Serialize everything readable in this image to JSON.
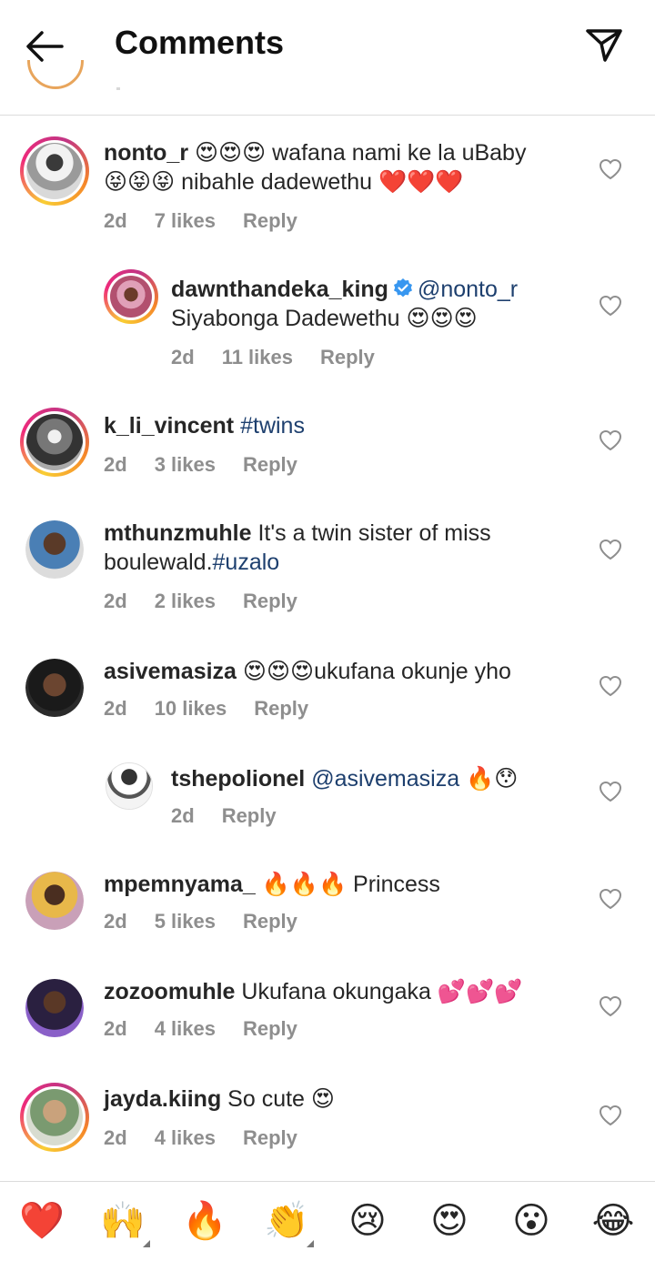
{
  "header": {
    "title": "Comments",
    "back_icon": "arrow-left-icon",
    "share_icon": "paper-plane-icon"
  },
  "comments": [
    {
      "username": "nonto_r",
      "text_line1": "😍😍😍 wafana nami ke la uBaby",
      "text_line2": "😝😝😝 nibahle dadewethu ❤️❤️❤️",
      "time": "2d",
      "likes": "7 likes",
      "reply": "Reply"
    },
    {
      "username": "dawnthandeka_king",
      "mention": "@nonto_r",
      "text_line2": "Siyabonga Dadewethu 😍😍😍",
      "time": "2d",
      "likes": "11 likes",
      "reply": "Reply"
    },
    {
      "username": "k_li_vincent",
      "hashtag": "#twins",
      "time": "2d",
      "likes": "3 likes",
      "reply": "Reply"
    },
    {
      "username": "mthunzmuhle",
      "text_line1": "It's a twin sister of miss",
      "text_line2": "boulewald.",
      "hashtag": "#uzalo",
      "time": "2d",
      "likes": "2 likes",
      "reply": "Reply"
    },
    {
      "username": "asivemasiza",
      "text_line1": "😍😍😍ukufana okunje yho",
      "time": "2d",
      "likes": "10 likes",
      "reply": "Reply"
    },
    {
      "username": "tshepolionel",
      "mention": "@asivemasiza",
      "text_line1": "🔥😯",
      "time": "2d",
      "reply": "Reply"
    },
    {
      "username": "mpemnyama_",
      "text_line1": "🔥🔥🔥 Princess",
      "time": "2d",
      "likes": "5 likes",
      "reply": "Reply"
    },
    {
      "username": "zozoomuhle",
      "text_line1": "Ukufana okungaka 💕💕💕",
      "time": "2d",
      "likes": "4 likes",
      "reply": "Reply"
    },
    {
      "username": "jayda.kiing",
      "text_line1": "So cute 😍",
      "time": "2d",
      "likes": "4 likes",
      "reply": "Reply"
    }
  ],
  "emoji_bar": [
    "❤️",
    "🙌",
    "🔥",
    "👏",
    "😢",
    "😍",
    "😮",
    "😂"
  ],
  "colors": {
    "text": "#262626",
    "meta": "#8e8e8e",
    "link": "#1d3f6e",
    "verified": "#3897f0",
    "divider": "#dbdbdb"
  }
}
